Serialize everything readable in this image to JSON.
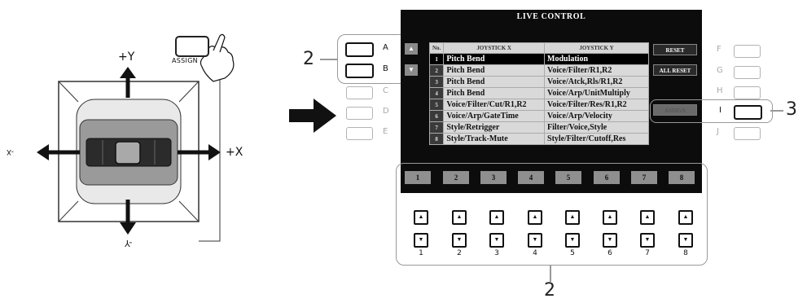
{
  "joystick": {
    "label_up": "+Y",
    "label_right": "+X",
    "label_left": "-X",
    "label_down": "-Y",
    "assign_label": "ASSIGN"
  },
  "screen": {
    "title": "LIVE CONTROL",
    "headers": {
      "no": "No.",
      "x": "JOYSTICK X",
      "y": "JOYSTICK Y"
    },
    "rows": [
      {
        "no": "1",
        "x": "Pitch Bend",
        "y": "Modulation",
        "selected": true
      },
      {
        "no": "2",
        "x": "Pitch Bend",
        "y": "Voice/Filter/R1,R2"
      },
      {
        "no": "3",
        "x": "Pitch Bend",
        "y": "Voice/Atck,Rls/R1,R2"
      },
      {
        "no": "4",
        "x": "Pitch Bend",
        "y": "Voice/Arp/UnitMultiply"
      },
      {
        "no": "5",
        "x": "Voice/Filter/Cut/R1,R2",
        "y": "Voice/Filter/Res/R1,R2"
      },
      {
        "no": "6",
        "x": "Voice/Arp/GateTime",
        "y": "Voice/Arp/Velocity"
      },
      {
        "no": "7",
        "x": "Style/Retrigger",
        "y": "Filter/Voice,Style"
      },
      {
        "no": "8",
        "x": "Style/Track-Mute",
        "y": "Style/Filter/Cutoff,Res"
      }
    ],
    "reset_label": "RESET",
    "all_reset_label": "ALL RESET",
    "assign_label": "ASSIGN",
    "page_up": "▲",
    "page_down": "▼",
    "number_tabs": [
      "1",
      "2",
      "3",
      "4",
      "5",
      "6",
      "7",
      "8"
    ]
  },
  "left_buttons": [
    "A",
    "B",
    "C",
    "D",
    "E"
  ],
  "right_buttons": [
    "F",
    "G",
    "H",
    "I",
    "J"
  ],
  "bottom_columns": [
    "1",
    "2",
    "3",
    "4",
    "5",
    "6",
    "7",
    "8"
  ],
  "arrow_up_glyph": "▲",
  "arrow_down_glyph": "▼",
  "callouts": {
    "left": "2",
    "right": "3",
    "bottom": "2"
  },
  "colors": {
    "screen_bg": "#0c0c0c",
    "selected_row": "#000000",
    "row_bg": "#d9d9d9"
  }
}
